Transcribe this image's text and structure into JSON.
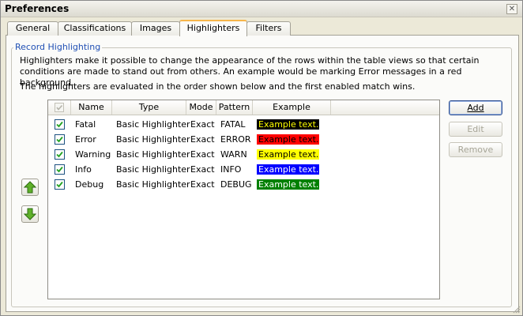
{
  "window": {
    "title": "Preferences",
    "close_symbol": "✕"
  },
  "tabs": [
    {
      "label": "General"
    },
    {
      "label": "Classifications"
    },
    {
      "label": "Images"
    },
    {
      "label": "Highlighters",
      "active": true
    },
    {
      "label": "Filters"
    }
  ],
  "group": {
    "label": "Record Highlighting",
    "description1": "Highlighters make it possible to change the appearance of the rows within the table views so that certain conditions are made to stand out from others. An example would be marking Error messages in a red background.",
    "description2": "The highlighters are evaluated in the order shown below and the first enabled match wins."
  },
  "table": {
    "columns": [
      "Name",
      "Type",
      "Mode",
      "Pattern",
      "Example"
    ],
    "rows": [
      {
        "enabled": true,
        "name": "Fatal",
        "type": "Basic Highlighter",
        "mode": "Exact",
        "pattern": "FATAL",
        "example": "Example text....",
        "fg": "#ffff00",
        "bg": "#000000"
      },
      {
        "enabled": true,
        "name": "Error",
        "type": "Basic Highlighter",
        "mode": "Exact",
        "pattern": "ERROR",
        "example": "Example text....",
        "fg": "#000000",
        "bg": "#ff0000"
      },
      {
        "enabled": true,
        "name": "Warning",
        "type": "Basic Highlighter",
        "mode": "Exact",
        "pattern": "WARN",
        "example": "Example text....",
        "fg": "#000000",
        "bg": "#ffff00"
      },
      {
        "enabled": true,
        "name": "Info",
        "type": "Basic Highlighter",
        "mode": "Exact",
        "pattern": "INFO",
        "example": "Example text....",
        "fg": "#ffffff",
        "bg": "#0000ff"
      },
      {
        "enabled": true,
        "name": "Debug",
        "type": "Basic Highlighter",
        "mode": "Exact",
        "pattern": "DEBUG",
        "example": "Example text....",
        "fg": "#ffffff",
        "bg": "#008000"
      }
    ]
  },
  "buttons": {
    "add": "Add",
    "edit": "Edit",
    "remove": "Remove"
  },
  "icons": {
    "move_up": "arrow-up-icon",
    "move_down": "arrow-down-icon"
  }
}
